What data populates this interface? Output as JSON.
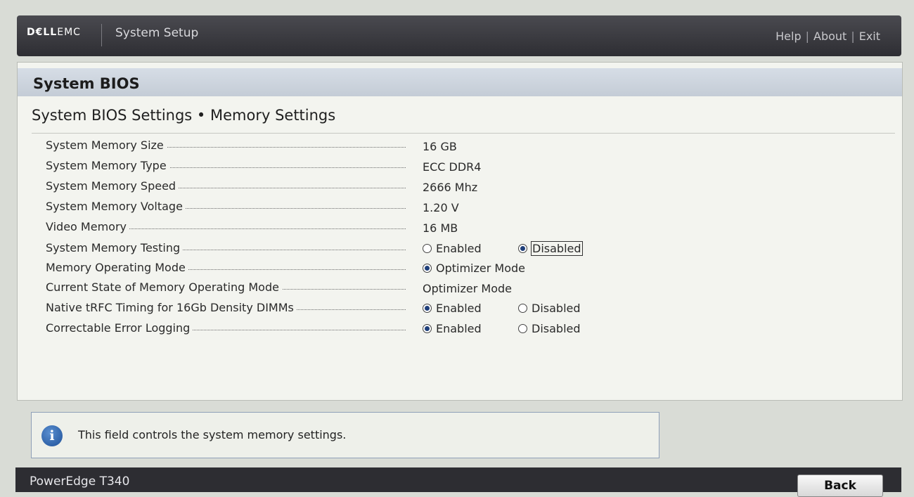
{
  "header": {
    "brand_bold": "D€LL",
    "brand_rest": "EMC",
    "app_title": "System Setup",
    "links": [
      "Help",
      "About",
      "Exit"
    ],
    "separator": "|"
  },
  "panel": {
    "title": "System BIOS",
    "breadcrumb": "System BIOS Settings • Memory Settings"
  },
  "settings": [
    {
      "label": "System Memory Size",
      "value": "16 GB"
    },
    {
      "label": "System Memory Type",
      "value": "ECC DDR4"
    },
    {
      "label": "System Memory Speed",
      "value": "2666 Mhz"
    },
    {
      "label": "System Memory Voltage",
      "value": "1.20 V"
    },
    {
      "label": "Video Memory",
      "value": "16 MB"
    },
    {
      "label": "System Memory Testing",
      "options": [
        {
          "text": "Enabled",
          "selected": false
        },
        {
          "text": "Disabled",
          "selected": true,
          "focused": true
        }
      ]
    },
    {
      "label": "Memory Operating Mode",
      "options": [
        {
          "text": "Optimizer Mode",
          "selected": true
        }
      ]
    },
    {
      "label": "Current State of Memory Operating Mode",
      "value": "Optimizer Mode"
    },
    {
      "label": "Native tRFC Timing for 16Gb Density DIMMs",
      "options": [
        {
          "text": "Enabled",
          "selected": true
        },
        {
          "text": "Disabled",
          "selected": false
        }
      ]
    },
    {
      "label": "Correctable Error Logging",
      "options": [
        {
          "text": "Enabled",
          "selected": true
        },
        {
          "text": "Disabled",
          "selected": false
        }
      ]
    }
  ],
  "info": {
    "icon": "info-icon",
    "glyph": "i",
    "text": "This field controls the system memory settings."
  },
  "footer": {
    "model": "PowerEdge T340",
    "back_label": "Back"
  },
  "colors": {
    "topbar": "#2e2e33",
    "panel_header": "#c4ccd6",
    "radio_fill": "#1f3f7a",
    "info_icon": "#1d4f98"
  }
}
